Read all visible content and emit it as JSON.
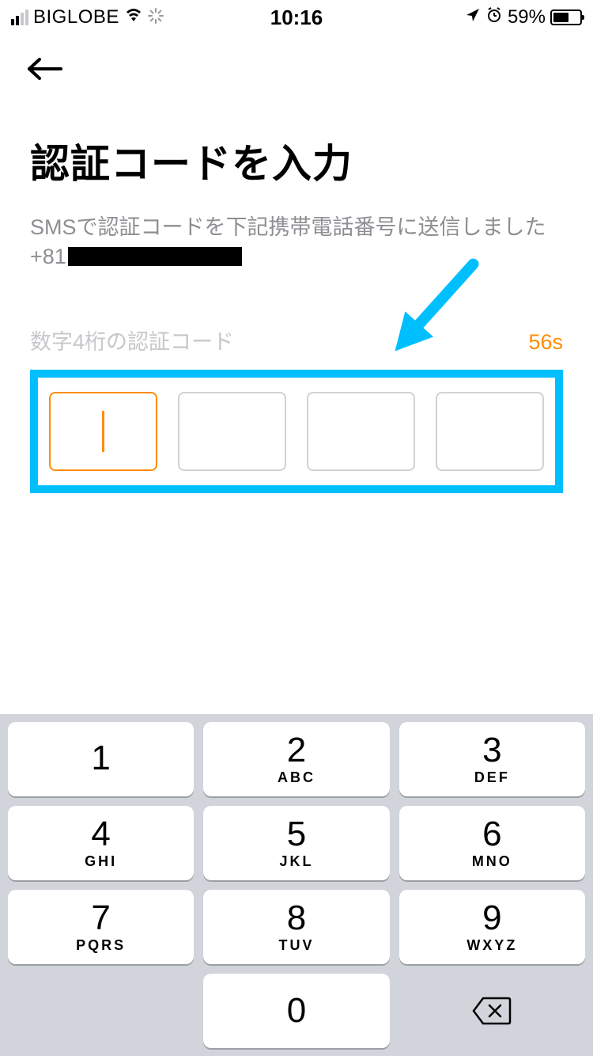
{
  "status": {
    "carrier": "BIGLOBE",
    "time": "10:16",
    "battery_pct": "59%"
  },
  "page": {
    "title": "認証コードを入力",
    "subtitle": "SMSで認証コードを下記携帯電話番号に送信しました",
    "phone_prefix": "+81",
    "code_label": "数字4桁の認証コード",
    "timer": "56s"
  },
  "keypad": {
    "keys": [
      {
        "num": "1",
        "letters": ""
      },
      {
        "num": "2",
        "letters": "ABC"
      },
      {
        "num": "3",
        "letters": "DEF"
      },
      {
        "num": "4",
        "letters": "GHI"
      },
      {
        "num": "5",
        "letters": "JKL"
      },
      {
        "num": "6",
        "letters": "MNO"
      },
      {
        "num": "7",
        "letters": "PQRS"
      },
      {
        "num": "8",
        "letters": "TUV"
      },
      {
        "num": "9",
        "letters": "WXYZ"
      },
      {
        "num": "0",
        "letters": ""
      }
    ]
  }
}
